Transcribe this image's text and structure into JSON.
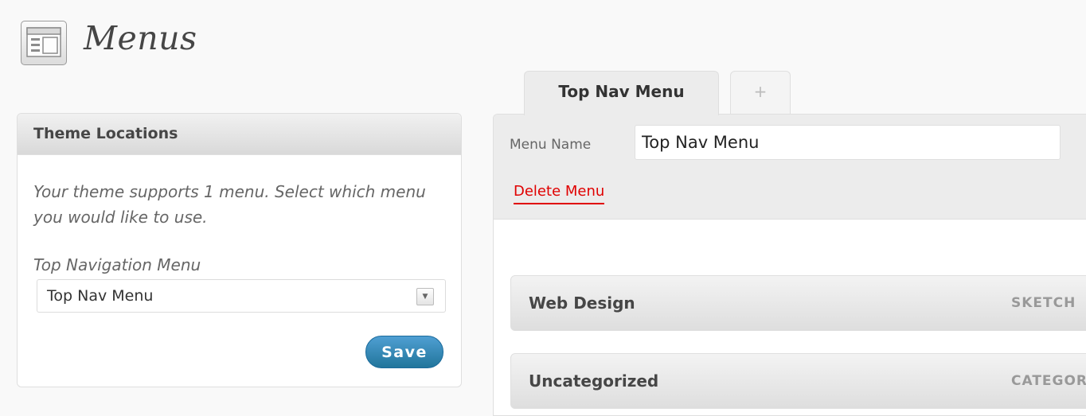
{
  "page": {
    "title": "Menus"
  },
  "theme_locations": {
    "heading": "Theme Locations",
    "description": "Your theme supports 1 menu. Select which menu you would like to use.",
    "location_label": "Top Navigation Menu",
    "selected_menu": "Top Nav Menu",
    "save_label": "Save"
  },
  "tabs": [
    {
      "label": "Top Nav Menu",
      "active": true
    },
    {
      "label": "+",
      "active": false
    }
  ],
  "menu_editor": {
    "name_label": "Menu Name",
    "name_value": "Top Nav Menu",
    "delete_label": "Delete Menu",
    "items": [
      {
        "title": "Web Design",
        "type": "SKETCH"
      },
      {
        "title": "Uncategorized",
        "type": "CATEGORY"
      }
    ]
  },
  "colors": {
    "primary_button": "#21759b",
    "delete_link": "#e00000"
  },
  "icons": {
    "page_icon": "layout-icon",
    "dropdown": "chevron-down-icon"
  }
}
